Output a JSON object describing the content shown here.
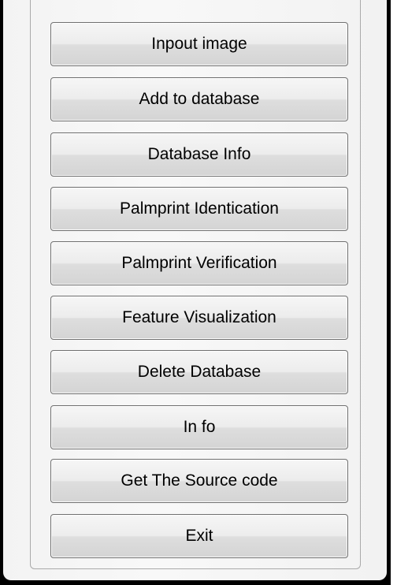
{
  "buttons": [
    {
      "label": "Inpout image"
    },
    {
      "label": "Add to database"
    },
    {
      "label": "Database Info"
    },
    {
      "label": "Palmprint Identication"
    },
    {
      "label": "Palmprint Verification"
    },
    {
      "label": "Feature Visualization"
    },
    {
      "label": "Delete Database"
    },
    {
      "label": "In fo"
    },
    {
      "label": "Get The Source code"
    },
    {
      "label": "Exit"
    }
  ],
  "colors": {
    "frame": "#000000",
    "panel_background": "#f4f4f4",
    "button_border": "#707070",
    "text": "#000000"
  }
}
